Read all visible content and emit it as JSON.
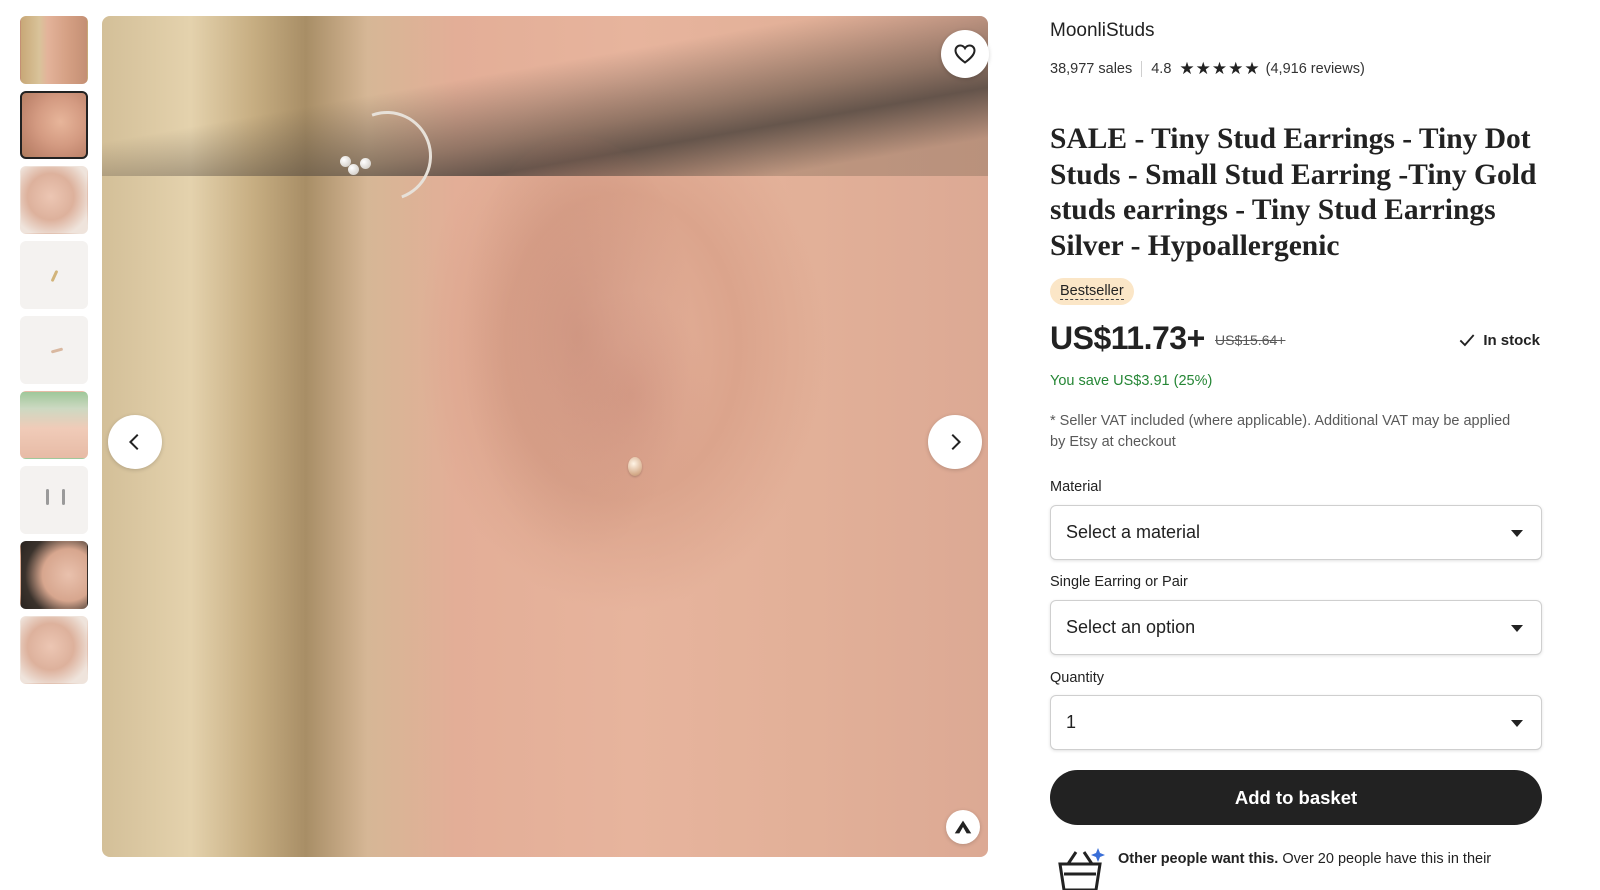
{
  "gallery": {
    "thumbnails": [
      {
        "label": "Ear with studs",
        "selected": false
      },
      {
        "label": "Ear with hoop and stud",
        "selected": true
      },
      {
        "label": "Ear close-up",
        "selected": false
      },
      {
        "label": "Single stud on white",
        "selected": false
      },
      {
        "label": "Stud lying on white",
        "selected": false
      },
      {
        "label": "Stud held in fingers",
        "selected": false
      },
      {
        "label": "Pair of studs",
        "selected": false
      },
      {
        "label": "Model profile",
        "selected": false
      },
      {
        "label": "Ear studs close-up",
        "selected": false
      }
    ],
    "favorite_icon": "heart-outline-icon",
    "prev_icon": "chevron-left-icon",
    "next_icon": "chevron-right-icon",
    "badge_icon": "star-seller-icon"
  },
  "shop": {
    "name": "MoonliStuds",
    "sales": "38,977 sales",
    "rating": "4.8",
    "stars": 5,
    "reviews": "(4,916 reviews)"
  },
  "listing": {
    "title": "SALE - Tiny Stud Earrings - Tiny Dot Studs - Small Stud Earring -Tiny Gold studs earrings - Tiny Stud Earrings Silver - Hypoallergenic",
    "badge": "Bestseller",
    "price": "US$11.73+",
    "original_price": "US$15.64+",
    "stock": "In stock",
    "savings": "You save US$3.91 (25%)",
    "vat_note": "* Seller VAT included (where applicable). Additional VAT may be applied by Etsy at checkout"
  },
  "options": {
    "material_label": "Material",
    "material_value": "Select a material",
    "pair_label": "Single Earring or Pair",
    "pair_value": "Select an option",
    "quantity_label": "Quantity",
    "quantity_value": "1"
  },
  "actions": {
    "add_to_basket": "Add to basket"
  },
  "demand": {
    "bold": "Other people want this.",
    "text": " Over 20 people have this in their"
  },
  "colors": {
    "accent_dark": "#222222",
    "bestseller_bg": "#fbe6c7",
    "savings_green": "#258635"
  }
}
